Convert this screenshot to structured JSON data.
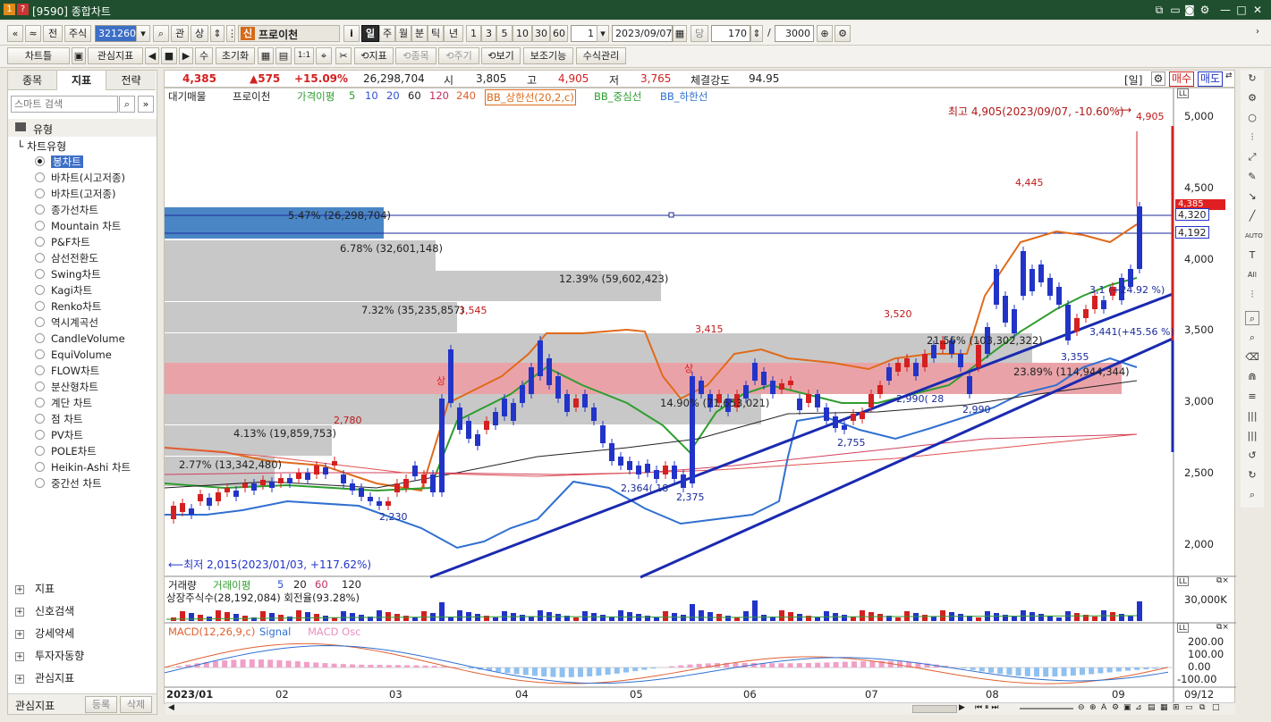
{
  "window": {
    "title": "[9590] 종합차트"
  },
  "toolbar1": {
    "nav_first": "«",
    "nav_up": "≈",
    "prev": "전",
    "market": "주식",
    "code": "321260",
    "search_icon_label": "관",
    "sangsang": "상",
    "sin_badge": "신",
    "stock_name": "프로이천",
    "info_btn": "i",
    "periods": [
      "일",
      "주",
      "월",
      "분",
      "틱",
      "년"
    ],
    "period_nums": [
      "1",
      "3",
      "5",
      "10",
      "30",
      "60"
    ],
    "period_value": "1",
    "date": "2023/09/07",
    "dang": "당",
    "count": "170",
    "slash": "/",
    "max_count": "3000"
  },
  "toolbar2": {
    "chart_tools": "차트틀",
    "watch_indicator": "관심지표",
    "num_label": "수",
    "reset": "초기화",
    "one_to_one": "1:1",
    "add_indicator": "지표",
    "add_stock": "종목",
    "add_period": "주기",
    "view": "보기",
    "aux": "보조기능",
    "formula": "수식관리"
  },
  "leftpanel": {
    "tabs": [
      "종목",
      "지표",
      "전략"
    ],
    "search_placeholder": "스마트 검색",
    "type_header": "유형",
    "chart_type_group": "차트유형",
    "chart_types": [
      "봉차트",
      "바차트(시고저종)",
      "바차트(고저종)",
      "종가선차트",
      "Mountain 차트",
      "P&F차트",
      "삼선전환도",
      "Swing차트",
      "Kagi차트",
      "Renko차트",
      "역시계곡선",
      "CandleVolume",
      "EquiVolume",
      "FLOW차트",
      "분산형차트",
      "계단 차트",
      "점 차트",
      "PV차트",
      "POLE차트",
      "Heikin-Ashi 차트",
      "중간선 차트"
    ],
    "sections": [
      "지표",
      "신호검색",
      "강세약세",
      "투자자동향",
      "관심지표"
    ],
    "bottom_label": "관심지표",
    "register_btn": "등록",
    "delete_btn": "삭제"
  },
  "infobar": {
    "price": "4,385",
    "change": "▲575",
    "change_pct": "+15.09%",
    "volume": "26,298,704",
    "open_label": "시",
    "open": "3,805",
    "high_label": "고",
    "high": "4,905",
    "low_label": "저",
    "low": "3,765",
    "strength_label": "체결강도",
    "strength": "94.95",
    "period_tag": "[일]",
    "buy": "매수",
    "sell": "매도"
  },
  "legend": {
    "items": [
      "대기매물",
      "프로이천",
      "가격이평",
      "5",
      "10",
      "20",
      "60",
      "120",
      "240",
      "BB_상한선(20,2,c)",
      "BB_중심선",
      "BB_하한선"
    ],
    "colors": [
      "#222222",
      "#222222",
      "#2e9d2e",
      "#2e9d2e",
      "#3050d0",
      "#3050d0",
      "#222222",
      "#c03060",
      "#e06030",
      "#e06a1a",
      "#2e9d2e",
      "#3070d0"
    ]
  },
  "price_chart": {
    "high_note": "최고 4,905(2023/09/07, -10.60%)",
    "low_note": "최저 2,015(2023/01/03, +117.62%)",
    "y_ticks": [
      "5,000",
      "4,500",
      "4,000",
      "3,500",
      "3,000",
      "2,500",
      "2,000"
    ],
    "current_tags": [
      "4,385",
      "4,320",
      "4,192"
    ],
    "volume_profile": [
      "5.47% (26,298,704)",
      "6.78% (32,601,148)",
      "12.39% (59,602,423)",
      "7.32% (35,235,857)",
      "14.90% (71,653,021)",
      "4.13% (19,859,753)",
      "2.77% (13,342,480)",
      "23.89% (114,944,344)",
      "21.56% (103,302,322)"
    ],
    "price_labels": [
      "4,905",
      "4,445",
      "3,520",
      "3,415",
      "3,545",
      "2,780",
      "2,230",
      "2,364( 18",
      "2,375",
      "2,755",
      "2,990( 28",
      "2,990",
      "3,355",
      "3,441(+45.56 %)",
      "3,1 (+24.92 %)"
    ],
    "trend_markers": [
      "상",
      "상"
    ]
  },
  "volume_panel": {
    "legend": [
      "거래량",
      "거래이평",
      "5",
      "20",
      "60",
      "120"
    ],
    "shares_note": "상장주식수(28,192,084) 회전율(93.28%)",
    "y_tick": "30,000K"
  },
  "macd_panel": {
    "legend": [
      "MACD(12,26,9,c)",
      "Signal",
      "MACD Osc"
    ],
    "y_ticks": [
      "200.00",
      "100.00",
      "0.00",
      "-100.00"
    ]
  },
  "x_axis": {
    "labels": [
      "2023/01",
      "02",
      "03",
      "04",
      "05",
      "06",
      "07",
      "08",
      "09"
    ],
    "end_label": "09/12"
  },
  "colors": {
    "up": "#d42020",
    "down": "#2234c8",
    "vp_blue": "#4a86c5",
    "vp_pink": "#e9a3a8",
    "vp_gray": "#c8c8c8"
  }
}
